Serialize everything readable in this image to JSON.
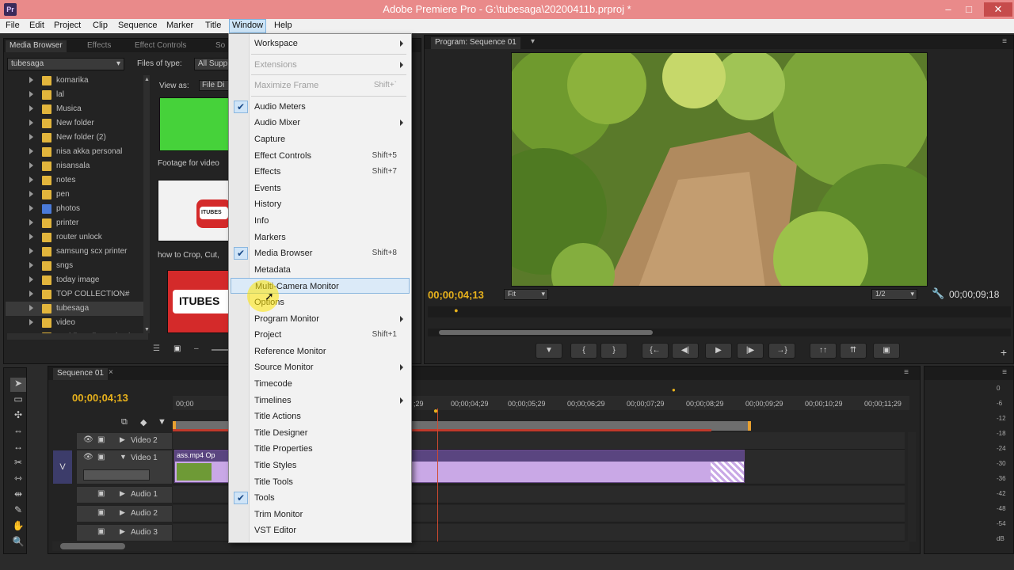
{
  "window": {
    "title": "Adobe Premiere Pro - G:\\tubesaga\\20200411b.prproj *",
    "app_icon": "Pr",
    "minimize": "–",
    "maximize": "□",
    "close": "✕"
  },
  "menubar": [
    "File",
    "Edit",
    "Project",
    "Clip",
    "Sequence",
    "Marker",
    "Title",
    "Window",
    "Help"
  ],
  "media_browser": {
    "tabs": [
      "Media Browser",
      "Effects",
      "Effect Controls",
      "So"
    ],
    "location": "tubesaga",
    "files_of_type_label": "Files of type:",
    "files_of_type_value": "All Supp",
    "view_as_label": "View as:",
    "view_as_value": "File Di",
    "folders": [
      {
        "name": "komarika",
        "icon": "folder-icon",
        "selected": false
      },
      {
        "name": "lal",
        "icon": "folder-icon",
        "selected": false
      },
      {
        "name": "Musica",
        "icon": "folder-icon",
        "selected": false
      },
      {
        "name": "New folder",
        "icon": "folder-icon",
        "selected": false
      },
      {
        "name": "New folder (2)",
        "icon": "folder-icon",
        "selected": false
      },
      {
        "name": "nisa akka personal",
        "icon": "folder-icon",
        "selected": false
      },
      {
        "name": "nisansala",
        "icon": "folder-icon",
        "selected": false
      },
      {
        "name": "notes",
        "icon": "folder-icon",
        "selected": false
      },
      {
        "name": "pen",
        "icon": "folder-icon",
        "selected": false
      },
      {
        "name": "photos",
        "icon": "photos-folder-icon",
        "selected": false
      },
      {
        "name": "printer",
        "icon": "folder-icon",
        "selected": false
      },
      {
        "name": "router unlock",
        "icon": "folder-icon",
        "selected": false
      },
      {
        "name": "samsung scx printer",
        "icon": "folder-icon",
        "selected": false
      },
      {
        "name": "sngs",
        "icon": "folder-icon",
        "selected": false
      },
      {
        "name": "today image",
        "icon": "folder-icon",
        "selected": false
      },
      {
        "name": "TOP COLLECTION#",
        "icon": "folder-icon",
        "selected": false
      },
      {
        "name": "tubesaga",
        "icon": "folder-icon",
        "selected": true
      },
      {
        "name": "video",
        "icon": "folder-icon",
        "selected": false
      },
      {
        "name": "wedding album check",
        "icon": "folder-icon",
        "selected": false
      }
    ],
    "thumbs": [
      {
        "caption": "Footage for video"
      },
      {
        "caption": "how to Crop, Cut,"
      },
      {
        "caption": "",
        "logo_text": "ITUBES"
      }
    ],
    "thumb_logo_small": "ITUBES"
  },
  "window_menu": {
    "items": [
      {
        "label": "Workspace",
        "shortcut": "",
        "checked": false,
        "disabled": false,
        "submenu": true,
        "highlight": false
      },
      {
        "separator": true
      },
      {
        "label": "Extensions",
        "shortcut": "",
        "checked": false,
        "disabled": true,
        "submenu": true,
        "highlight": false
      },
      {
        "separator": true
      },
      {
        "label": "Maximize Frame",
        "shortcut": "Shift+`",
        "checked": false,
        "disabled": true,
        "submenu": false,
        "highlight": false
      },
      {
        "separator": true
      },
      {
        "label": "Audio Meters",
        "shortcut": "",
        "checked": true,
        "disabled": false,
        "submenu": false,
        "highlight": false
      },
      {
        "label": "Audio Mixer",
        "shortcut": "",
        "checked": false,
        "disabled": false,
        "submenu": true,
        "highlight": false
      },
      {
        "label": "Capture",
        "shortcut": "",
        "checked": false,
        "disabled": false,
        "submenu": false,
        "highlight": false
      },
      {
        "label": "Effect Controls",
        "shortcut": "Shift+5",
        "checked": false,
        "disabled": false,
        "submenu": false,
        "highlight": false
      },
      {
        "label": "Effects",
        "shortcut": "Shift+7",
        "checked": false,
        "disabled": false,
        "submenu": false,
        "highlight": false
      },
      {
        "label": "Events",
        "shortcut": "",
        "checked": false,
        "disabled": false,
        "submenu": false,
        "highlight": false
      },
      {
        "label": "History",
        "shortcut": "",
        "checked": false,
        "disabled": false,
        "submenu": false,
        "highlight": false
      },
      {
        "label": "Info",
        "shortcut": "",
        "checked": false,
        "disabled": false,
        "submenu": false,
        "highlight": false
      },
      {
        "label": "Markers",
        "shortcut": "",
        "checked": false,
        "disabled": false,
        "submenu": false,
        "highlight": false
      },
      {
        "label": "Media Browser",
        "shortcut": "Shift+8",
        "checked": true,
        "disabled": false,
        "submenu": false,
        "highlight": false
      },
      {
        "label": "Metadata",
        "shortcut": "",
        "checked": false,
        "disabled": false,
        "submenu": false,
        "highlight": false
      },
      {
        "label": "Multi-Camera Monitor",
        "shortcut": "",
        "checked": false,
        "disabled": false,
        "submenu": false,
        "highlight": true
      },
      {
        "label": "Options",
        "shortcut": "",
        "checked": false,
        "disabled": false,
        "submenu": false,
        "highlight": false
      },
      {
        "label": "Program Monitor",
        "shortcut": "",
        "checked": false,
        "disabled": false,
        "submenu": true,
        "highlight": false
      },
      {
        "label": "Project",
        "shortcut": "Shift+1",
        "checked": false,
        "disabled": false,
        "submenu": false,
        "highlight": false
      },
      {
        "label": "Reference Monitor",
        "shortcut": "",
        "checked": false,
        "disabled": false,
        "submenu": false,
        "highlight": false
      },
      {
        "label": "Source Monitor",
        "shortcut": "",
        "checked": false,
        "disabled": false,
        "submenu": true,
        "highlight": false
      },
      {
        "label": "Timecode",
        "shortcut": "",
        "checked": false,
        "disabled": false,
        "submenu": false,
        "highlight": false
      },
      {
        "label": "Timelines",
        "shortcut": "",
        "checked": false,
        "disabled": false,
        "submenu": true,
        "highlight": false
      },
      {
        "label": "Title Actions",
        "shortcut": "",
        "checked": false,
        "disabled": false,
        "submenu": false,
        "highlight": false
      },
      {
        "label": "Title Designer",
        "shortcut": "",
        "checked": false,
        "disabled": false,
        "submenu": false,
        "highlight": false
      },
      {
        "label": "Title Properties",
        "shortcut": "",
        "checked": false,
        "disabled": false,
        "submenu": false,
        "highlight": false
      },
      {
        "label": "Title Styles",
        "shortcut": "",
        "checked": false,
        "disabled": false,
        "submenu": false,
        "highlight": false
      },
      {
        "label": "Title Tools",
        "shortcut": "",
        "checked": false,
        "disabled": false,
        "submenu": false,
        "highlight": false
      },
      {
        "label": "Tools",
        "shortcut": "",
        "checked": true,
        "disabled": false,
        "submenu": false,
        "highlight": false
      },
      {
        "label": "Trim Monitor",
        "shortcut": "",
        "checked": false,
        "disabled": false,
        "submenu": false,
        "highlight": false
      },
      {
        "label": "VST Editor",
        "shortcut": "",
        "checked": false,
        "disabled": false,
        "submenu": false,
        "highlight": false
      }
    ]
  },
  "program_monitor": {
    "tab": "Program: Sequence 01",
    "current_tc": "00;00;04;13",
    "duration_tc": "00;00;09;18",
    "fit": "Fit",
    "resolution": "1/2",
    "playhead_progress": 0.045,
    "controls": [
      {
        "name": "add-marker-button",
        "glyph": "▼"
      },
      {
        "name": "mark-in-button",
        "glyph": "{"
      },
      {
        "name": "mark-out-button",
        "glyph": "}"
      },
      {
        "name": "go-to-in-button",
        "glyph": "{←"
      },
      {
        "name": "step-back-button",
        "glyph": "◀|"
      },
      {
        "name": "play-button",
        "glyph": "▶"
      },
      {
        "name": "step-forward-button",
        "glyph": "|▶"
      },
      {
        "name": "go-to-out-button",
        "glyph": "→}"
      },
      {
        "name": "lift-button",
        "glyph": "↑↑"
      },
      {
        "name": "extract-button",
        "glyph": "⇈"
      },
      {
        "name": "export-frame-button",
        "glyph": "▣"
      }
    ]
  },
  "timeline": {
    "tab": "Sequence 01",
    "current_tc": "00;00;04;13",
    "ruler": [
      "00;00",
      "00;00;04;29",
      "00;00;05;29",
      "00;00;06;29",
      "00;00;07;29",
      "00;00;08;29",
      "00;00;09;29",
      "00;00;10;29",
      "00;00;11;29"
    ],
    "ruler_partial": ";29",
    "tracks": [
      {
        "name": "Video 2",
        "type": "video"
      },
      {
        "name": "Video 1",
        "type": "video"
      },
      {
        "name": "Audio 1",
        "type": "audio"
      },
      {
        "name": "Audio 2",
        "type": "audio"
      },
      {
        "name": "Audio 3",
        "type": "audio"
      }
    ],
    "source_patch": "V",
    "clip_label": "ass.mp4 Op"
  },
  "audio_meters": [
    "0",
    "-6",
    "-12",
    "-18",
    "-24",
    "-30",
    "-36",
    "-42",
    "-48",
    "-54",
    "dB"
  ],
  "colors": {
    "title_bar": "#e98a8a",
    "timecode": "#e8b21c",
    "clip": "#c9a8e6",
    "playhead": "#d04a30"
  }
}
